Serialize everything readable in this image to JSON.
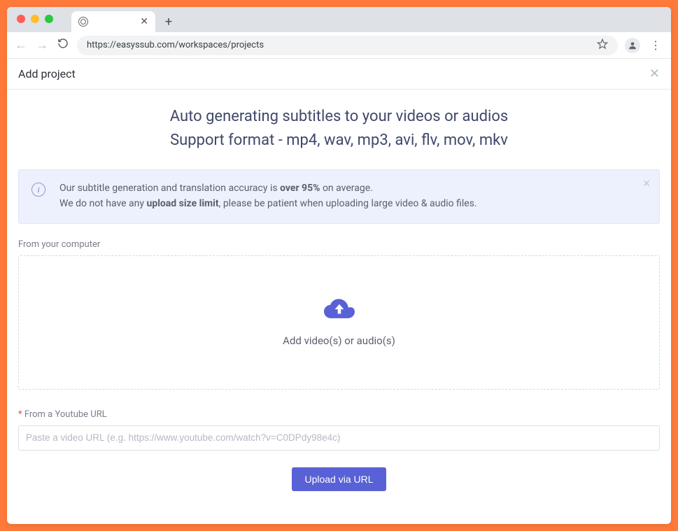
{
  "browser": {
    "url": "https://easyssub.com/workspaces/projects"
  },
  "page": {
    "title": "Add project",
    "headline_line1": "Auto generating subtitles to your videos or audios",
    "headline_line2": "Support format - mp4, wav, mp3, avi, flv, mov, mkv"
  },
  "alert": {
    "prefix": "Our subtitle generation and translation accuracy is ",
    "bold1": "over 95%",
    "mid1": " on average.",
    "line2_prefix": "We do not have any ",
    "bold2": "upload size limit",
    "line2_suffix": ", please be patient when uploading large video & audio files."
  },
  "upload": {
    "computer_label": "From your computer",
    "dropzone_text": "Add video(s) or audio(s)",
    "youtube_label": "From a Youtube URL",
    "url_placeholder": "Paste a video URL (e.g. https://www.youtube.com/watch?v=C0DPdy98e4c)",
    "button": "Upload via URL"
  }
}
